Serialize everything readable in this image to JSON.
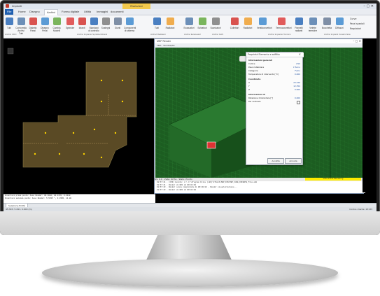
{
  "app": {
    "quick_access": "Impianti",
    "tabs": [
      "File",
      "Home",
      "Disegno",
      "Archivi",
      "Forma digitale",
      "Utilità",
      "Immagini",
      "documenti"
    ],
    "active_tab": "Archivi",
    "contextual_tab": "Risoluzioni"
  },
  "ribbon": {
    "buttons": [
      "Tubi",
      "Conformità Archivi Tubi",
      "Dialetto Passi",
      "Disegno Pezzi",
      "Cambia Modelli",
      "Sprinkler",
      "Idranti",
      "Standard di controllo",
      "Sostegni",
      "Giunti",
      "Componenti di sistema",
      "Tubi",
      "Radiatori",
      "Evacuatori",
      "Schiatturi",
      "Scaricatori",
      "Collettori",
      "Radiatori",
      "Ventilconvettori",
      "Termoconvettori",
      "Pannelli radianti",
      "Velette termiche",
      "Bocchetta",
      "Diffusori",
      "Curve",
      "Pezzi speciali",
      "Regolatori"
    ],
    "groups": [
      "Archivi CDO",
      "Archivi Impianto Sprinkler/Idranti",
      "Archivi Radiatori",
      "Archivi Evacuatori",
      "Archivi GAS",
      "Archivi impianto Termico",
      "Archivi impianti Canali d'aria"
    ]
  },
  "render": {
    "title": "MEP Render",
    "toolbar": "FMA · Vendita/Ab",
    "status": "RS: 0.0 · Vista: Ortho · Stato: Pronto",
    "log": [
      "19:57:41 - (CPZ) Evento: c:\\ C:\\Program Files (x86)\\ITALIA\\MEP_DIN\\MEP_FASE_DOCENTE_file.edb",
      "19:57:41 - Render di BO1 di BO:00:00",
      "19:57:43 - Render scena completata di BO:00:00 - Render visualizzazione...",
      "19:57:43 - Render di BO1 di BO:00:00",
      "19:57:43 - La scena attuale è aggiornata con l'ancoraggio MEP"
    ],
    "yellow_status": "Vista scena Rendering"
  },
  "properties": {
    "title": "Proprietà Elemento e soffitto",
    "sections": [
      {
        "label": "Informazioni generali",
        "rows": [
          {
            "k": "Codice",
            "v": "#10"
          },
          {
            "k": "Peso ristabiliare",
            "v": "il Turno"
          },
          {
            "k": "Categoria",
            "v": "Fumo"
          },
          {
            "k": "Temperatura di intervento [°C]",
            "v": "0.000"
          }
        ]
      },
      {
        "label": "Coordinate",
        "rows": [
          {
            "k": "X",
            "v": "23.226"
          },
          {
            "k": "Y",
            "v": "12.354"
          },
          {
            "k": "Z",
            "v": "0.000"
          }
        ]
      },
      {
        "label": "Informazioni di",
        "rows": [
          {
            "k": "Rotazione Orizzontale [°]",
            "v": "0.000"
          },
          {
            "k": "Per verticale",
            "v": ""
          }
        ]
      }
    ],
    "ok_label": "Accetta",
    "cancel_label": "Annulla"
  },
  "cad": {
    "cmdline": [
      "Inserisci primo punto: Asse Render: 39.3042, 16.1745, 0.3410",
      "Inserisci secondo punto: Asse Render: 5.5335 °, 3.3365, 14.08"
    ],
    "model_tab": "Selezione Entità"
  },
  "statusbar": {
    "left": "45.393, 5.291, 0.000 (m)",
    "right": "Codice cliente: 23133"
  },
  "colors": {
    "accent": "#1f5fb0",
    "render_green": "#1c5d21",
    "floor_plan": "#5a4a25",
    "yellow": "#ffeb00"
  }
}
